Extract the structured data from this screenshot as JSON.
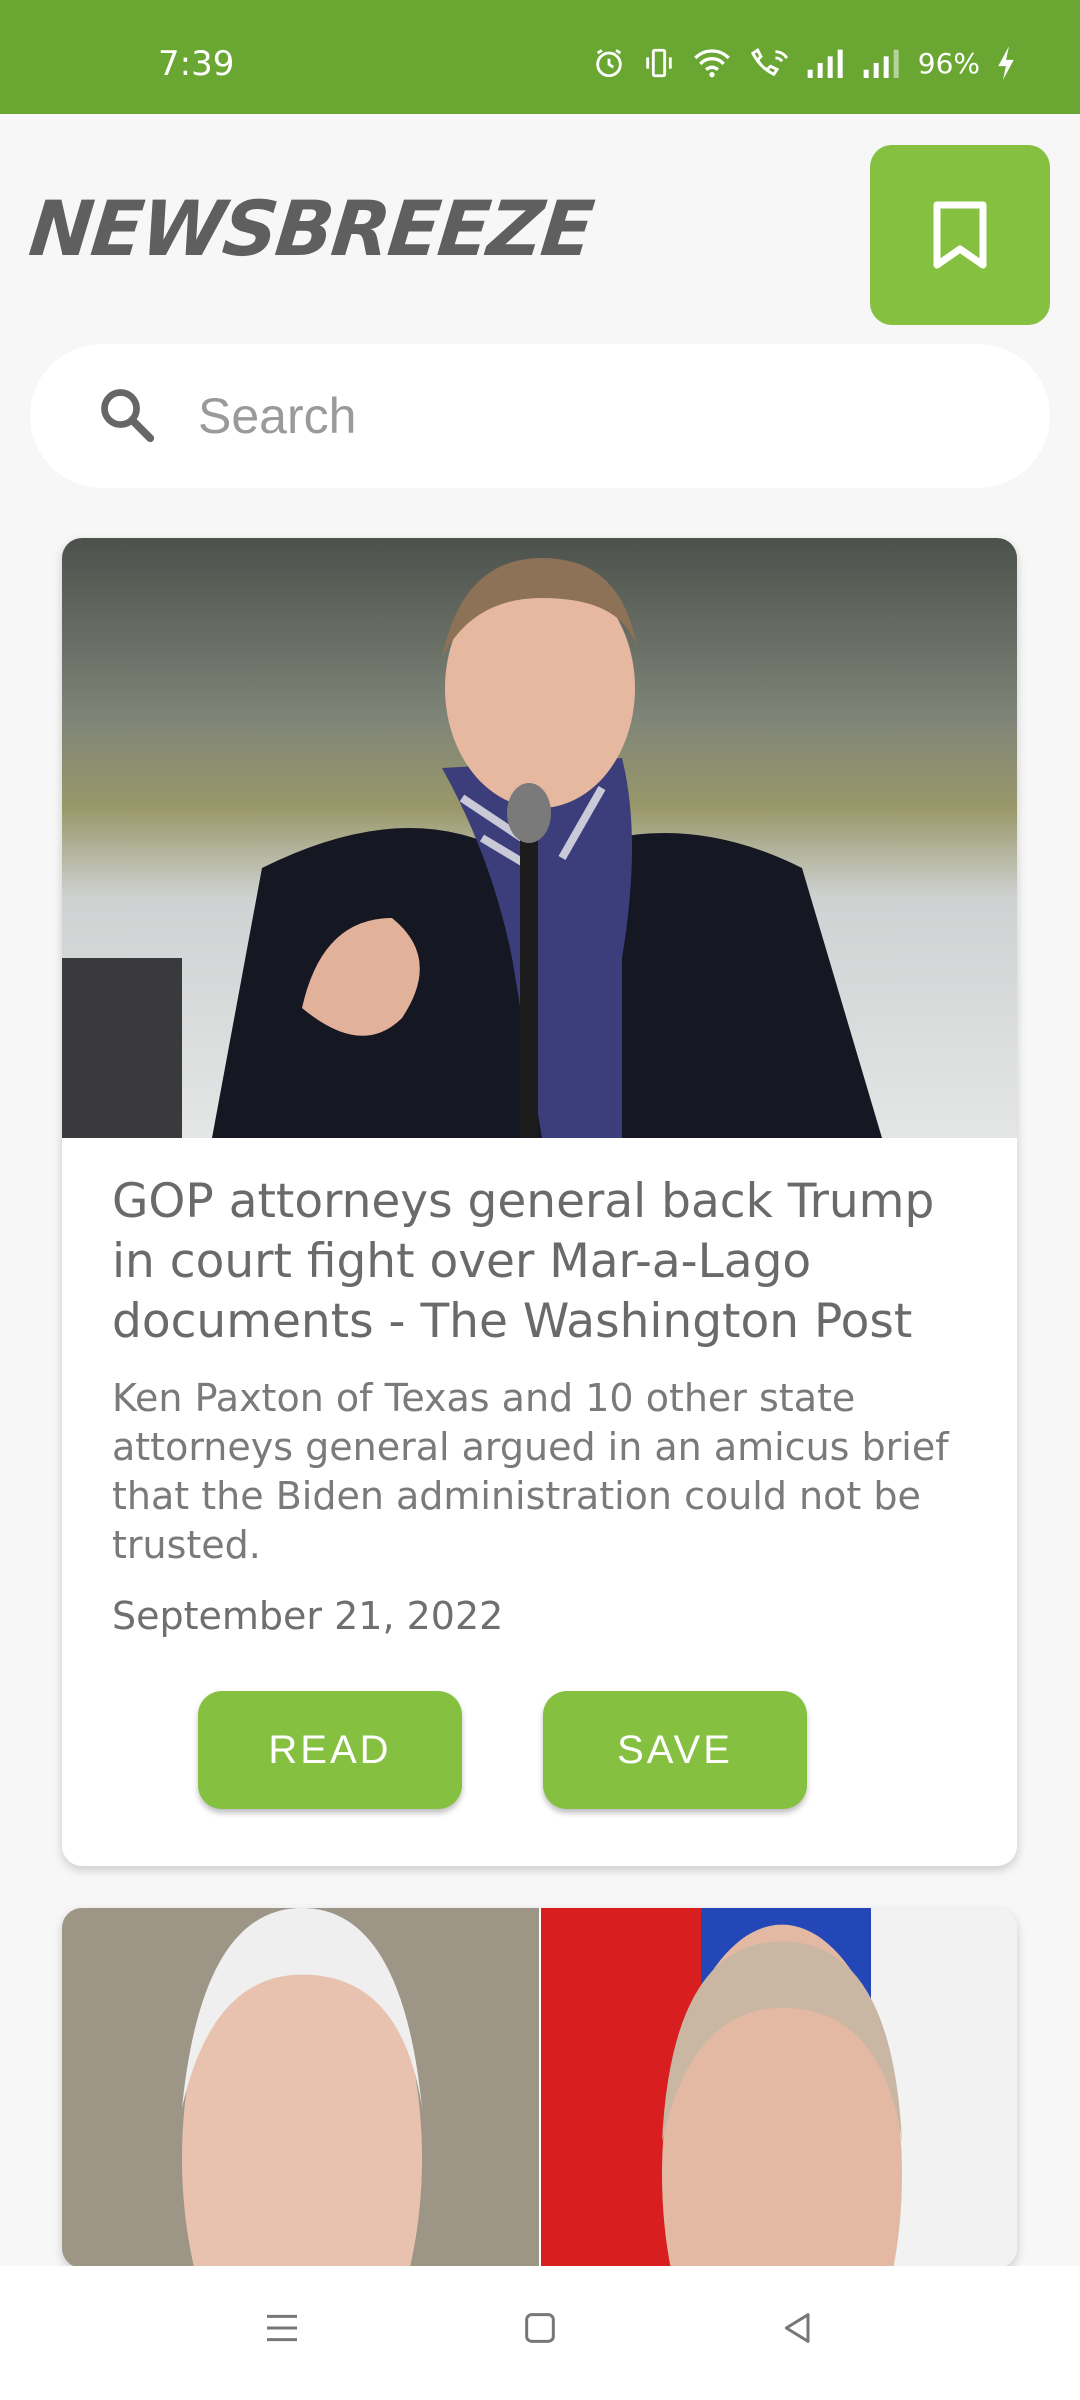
{
  "status_bar": {
    "time": "7:39",
    "battery": "96%",
    "icons": [
      "alarm-icon",
      "vibrate-icon",
      "wifi-icon",
      "wifi-calling-icon",
      "signal-icon",
      "signal-icon",
      "charging-icon"
    ]
  },
  "header": {
    "logo": "NEWSBREEZE",
    "bookmark_icon": "bookmark-icon"
  },
  "search": {
    "placeholder": "Search",
    "icon": "search-icon"
  },
  "articles": [
    {
      "title": "GOP attorneys general back Trump in court fight over Mar-a-Lago documents - The Washington Post",
      "description": "Ken Paxton of Texas and 10 other state attorneys general argued in an amicus brief that the Biden administration could not be trusted.",
      "date": "September 21, 2022",
      "read_label": "READ",
      "save_label": "SAVE"
    }
  ],
  "colors": {
    "status_bar": "#6aa632",
    "accent": "#85c041",
    "background": "#f7f7f7"
  },
  "nav": [
    "menu-icon",
    "home-icon",
    "back-icon"
  ]
}
